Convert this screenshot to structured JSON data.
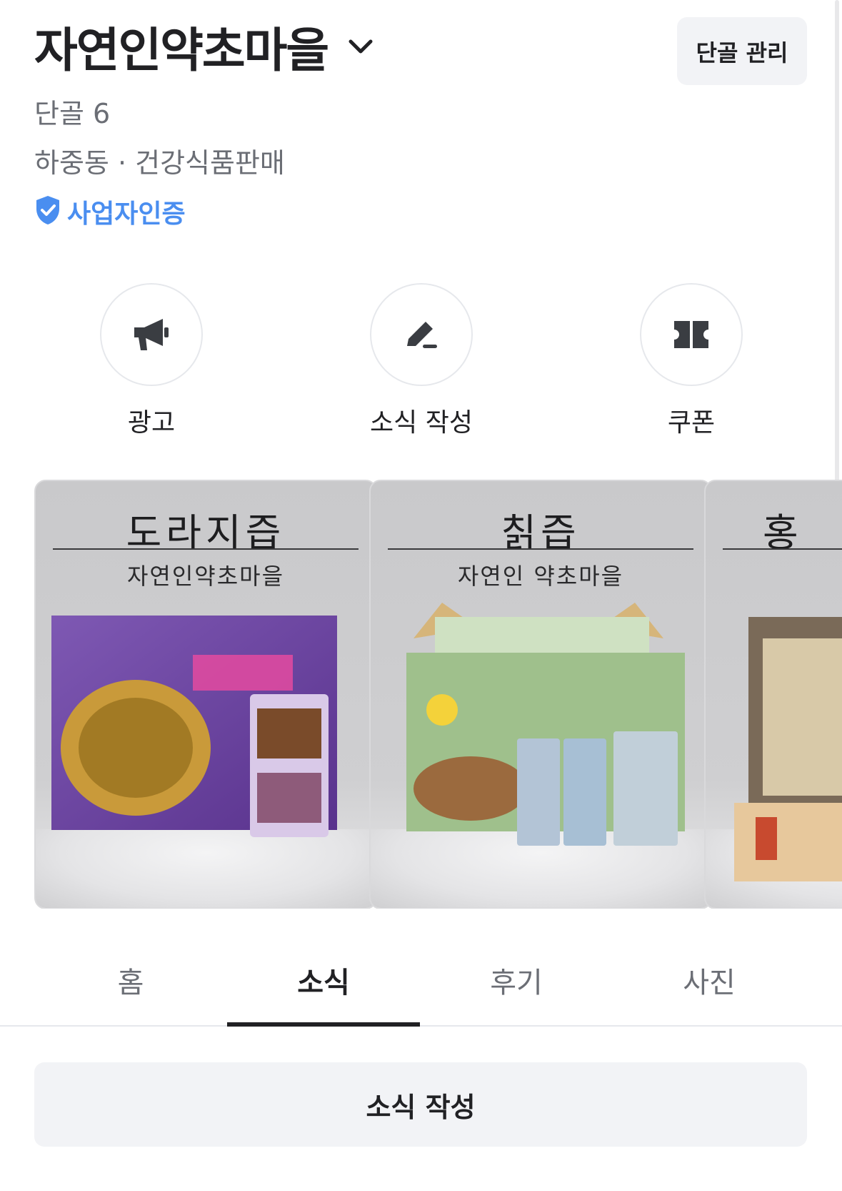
{
  "store": {
    "name": "자연인약초마을",
    "manage_label": "단골 관리",
    "regulars": "단골 6",
    "meta": "하중동 · 건강식품판매",
    "verified_label": "사업자인증"
  },
  "actions": [
    {
      "label": "광고",
      "icon": "megaphone-icon"
    },
    {
      "label": "소식 작성",
      "icon": "pencil-icon"
    },
    {
      "label": "쿠폰",
      "icon": "coupon-icon"
    }
  ],
  "gallery": [
    {
      "title": "도라지즙",
      "subtitle": "자연인약초마을"
    },
    {
      "title": "칡즙",
      "subtitle": "자연인 약초마을"
    },
    {
      "title": "홍",
      "subtitle": ""
    }
  ],
  "tabs": [
    {
      "label": "홈",
      "active": false
    },
    {
      "label": "소식",
      "active": true
    },
    {
      "label": "후기",
      "active": false
    },
    {
      "label": "사진",
      "active": false
    }
  ],
  "write_button_label": "소식 작성",
  "colors": {
    "accent_blue": "#4a8ef0",
    "text_primary": "#212124",
    "text_secondary": "#6b6e75",
    "button_bg": "#f2f3f6"
  }
}
